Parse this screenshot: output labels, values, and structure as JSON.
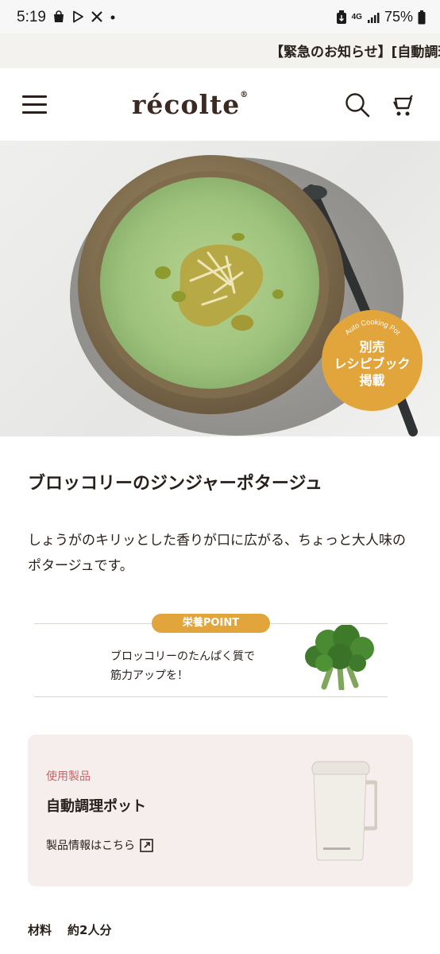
{
  "status_bar": {
    "time": "5:19",
    "network": "4G",
    "battery": "75%"
  },
  "notice": {
    "text": "【緊急のお知らせ】[自動調理ポット]"
  },
  "header": {
    "brand": "récolte",
    "brand_mark": "®"
  },
  "hero": {
    "badge_arc": "Auto Cooking Pot",
    "badge_lines": [
      "別売",
      "レシピブック",
      "掲載"
    ]
  },
  "recipe": {
    "title": "ブロッコリーのジンジャーポタージュ",
    "description": "しょうがのキリッとした香りが口に広がる、ちょっと大人味のポタージュです。"
  },
  "nutrition": {
    "label": "栄養POINT",
    "line1": "ブロッコリーのたんぱく質で",
    "line2": "筋力アップを！"
  },
  "product": {
    "section_label": "使用製品",
    "name": "自動調理ポット",
    "link_text": "製品情報はこちら"
  },
  "ingredients": {
    "label": "材料",
    "servings": "約2人分"
  },
  "colors": {
    "accent": "#e2a53b",
    "label_red": "#c8656a",
    "card_bg": "#f6eeec",
    "text": "#2a201b"
  },
  "icons": [
    "shopping-bag-icon",
    "play-store-icon",
    "x-icon",
    "menu-icon",
    "search-icon",
    "cart-icon",
    "external-link-icon"
  ]
}
